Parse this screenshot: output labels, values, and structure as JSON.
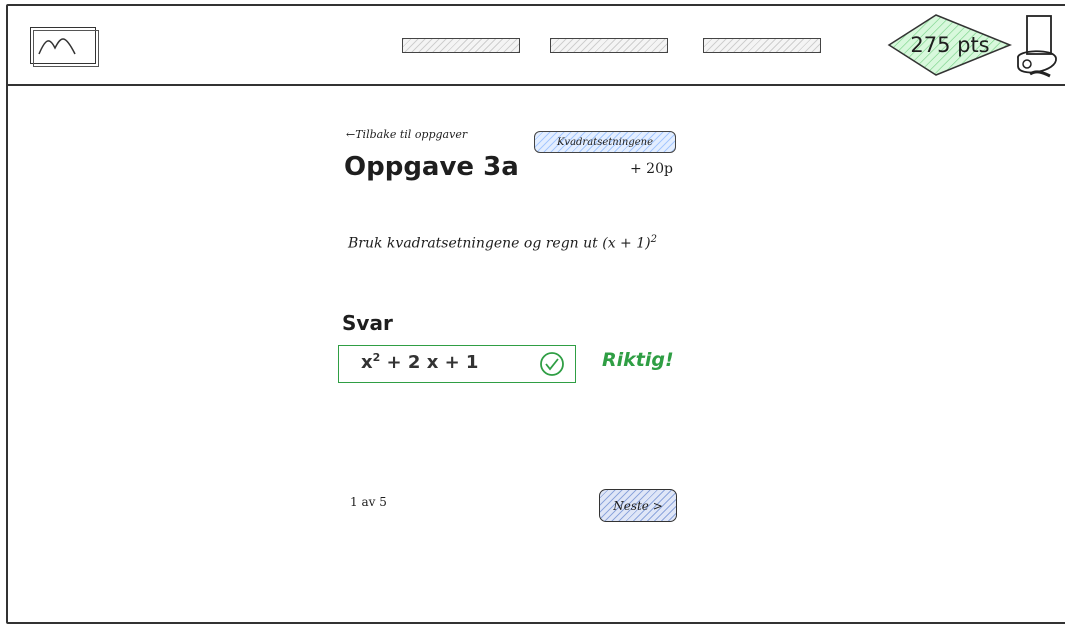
{
  "header": {
    "logo_icon": "mountain-icon",
    "nav_items": [
      "",
      "",
      ""
    ],
    "points": "275 pts",
    "points_color": "#b2f2bb",
    "avatar_icon": "monocle-avatar-icon"
  },
  "task": {
    "back_link": "←Tilbake til oppgaver",
    "topic_tag": "Kvadratsetningene",
    "title": "Oppgave 3a",
    "reward": "+ 20p",
    "question_text": "Bruk kvadratsetningene og regn ut (x + 1)",
    "question_exponent": "2"
  },
  "answer": {
    "label": "Svar",
    "base": "x",
    "exponent": "2",
    "rest": " + 2 x + 1",
    "status_icon": "check-circle-icon",
    "feedback": "Riktig!",
    "feedback_color": "#2f9e44"
  },
  "pagination": {
    "text": "1 av 5",
    "next_label": "Neste >"
  }
}
